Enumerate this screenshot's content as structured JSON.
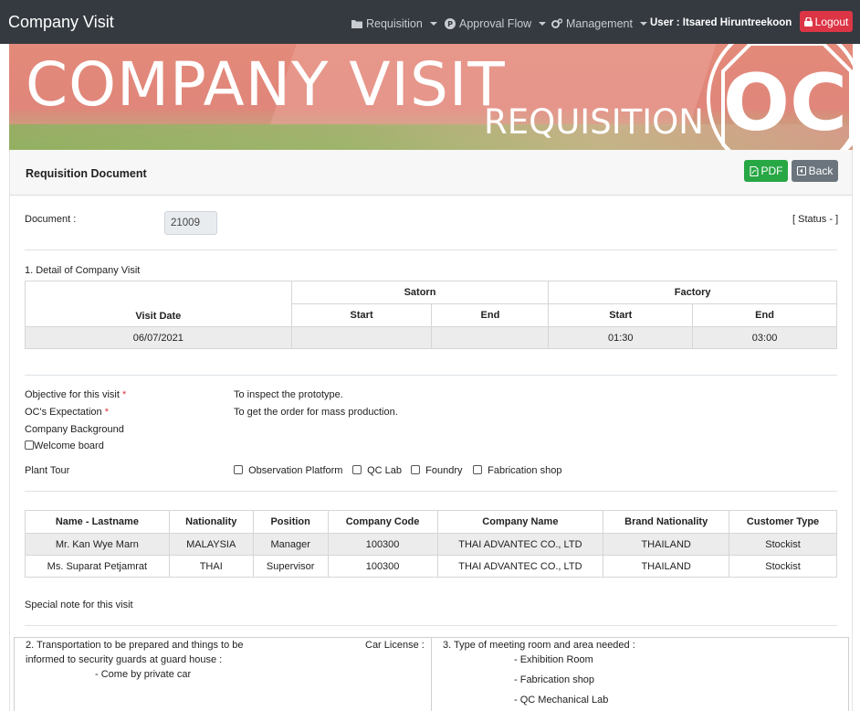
{
  "navbar": {
    "brand": "Company Visit",
    "menu": [
      {
        "label": "Requisition",
        "icon": "folder-icon"
      },
      {
        "label": "Approval Flow",
        "icon": "approval-p-icon"
      },
      {
        "label": "Management",
        "icon": "gears-icon"
      }
    ],
    "user": "User : Itsared Hiruntreekoon",
    "logout_label": "Logout"
  },
  "banner": {
    "title": "COMPANY VISIT",
    "subtitle": "REQUISITION",
    "logo_text": "OC"
  },
  "header": {
    "title": "Requisition Document",
    "pdf_label": "PDF",
    "back_label": "Back"
  },
  "document": {
    "label": "Document :",
    "value": "21009",
    "status": "[ Status - ]"
  },
  "visit_detail": {
    "section_title": "1. Detail of Company Visit",
    "group_satorn": "Satorn",
    "group_factory": "Factory",
    "col_visit_date": "Visit Date",
    "col_start": "Start",
    "col_end": "End",
    "row": {
      "visit_date": "06/07/2021",
      "satorn_start": "",
      "satorn_end": "",
      "factory_start": "01:30",
      "factory_end": "03:00"
    }
  },
  "info": {
    "objective_label": "Objective for this visit",
    "objective_value": "To inspect the prototype.",
    "expectation_label": "OC's Expectation",
    "expectation_value": "To get the order for mass production.",
    "background_label": "Company Background",
    "welcome_board_label": "Welcome board",
    "plant_tour_label": "Plant Tour",
    "plant_tour_options": [
      "Observation Platform",
      "QC Lab",
      "Foundry",
      "Fabrication shop"
    ],
    "required_mark": "*"
  },
  "visitors": {
    "headers": [
      "Name - Lastname",
      "Nationality",
      "Position",
      "Company Code",
      "Company Name",
      "Brand Nationality",
      "Customer Type"
    ],
    "rows": [
      [
        "Mr. Kan Wye Marn",
        "MALAYSIA",
        "Manager",
        "100300",
        "THAI ADVANTEC CO., LTD",
        "THAILAND",
        "Stockist"
      ],
      [
        "Ms. Suparat Petjamrat",
        "THAI",
        "Supervisor",
        "100300",
        "THAI ADVANTEC CO., LTD",
        "THAILAND",
        "Stockist"
      ]
    ]
  },
  "special_note_label": "Special note for this visit",
  "transport": {
    "title_line1": "2. Transportation to be prepared and things to be",
    "title_line2": "informed to security guards at guard house :",
    "car_license_label": "Car License :",
    "item": "- Come by private car"
  },
  "meeting": {
    "title": "3. Type of meeting room and area needed :",
    "items": [
      "- Exhibition Room",
      "- Fabrication shop",
      "- QC Mechanical Lab"
    ]
  },
  "colors": {
    "navbar": "#343a40",
    "danger": "#dc3545",
    "success": "#28a745",
    "secondary": "#6c757d"
  }
}
